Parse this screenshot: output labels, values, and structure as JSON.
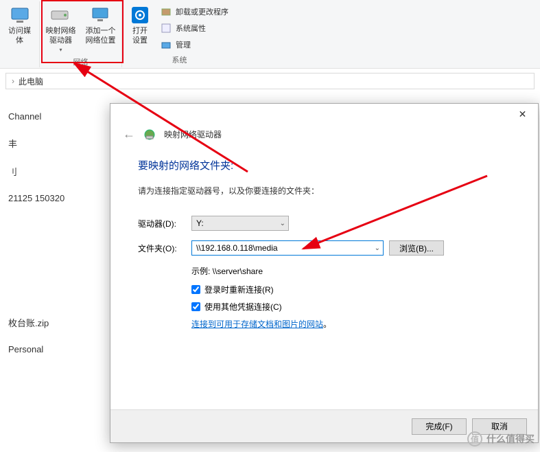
{
  "ribbon": {
    "media_btn": "访问媒体",
    "map_drive": "映射网络\n驱动器",
    "add_location": "添加一个\n网络位置",
    "group_network": "网络",
    "open_settings": "打开\n设置",
    "uninstall": "卸载或更改程序",
    "sys_props": "系统属性",
    "manage": "管理",
    "group_system": "系统"
  },
  "breadcrumb": {
    "text": "此电脑",
    "sep": "›"
  },
  "bg_items": {
    "a": "Channel",
    "b": "丰",
    "c": "刂",
    "d": "21125 150320",
    "e": "枚台账.zip",
    "f": "Personal"
  },
  "dialog": {
    "title": "映射网络驱动器",
    "h1": "要映射的网络文件夹:",
    "sub": "请为连接指定驱动器号，以及你要连接的文件夹：",
    "label_drive": "驱动器(D):",
    "drive_value": "Y:",
    "label_folder": "文件夹(O):",
    "folder_value": "\\\\192.168.0.118\\media",
    "browse": "浏览(B)...",
    "example": "示例: \\\\server\\share",
    "check_reconnect": "登录时重新连接(R)",
    "check_creds": "使用其他凭据连接(C)",
    "link_text": "连接到可用于存储文档和图片的网站",
    "link_period": "。",
    "finish": "完成(F)",
    "cancel": "取消"
  },
  "watermark": "什么值得买"
}
